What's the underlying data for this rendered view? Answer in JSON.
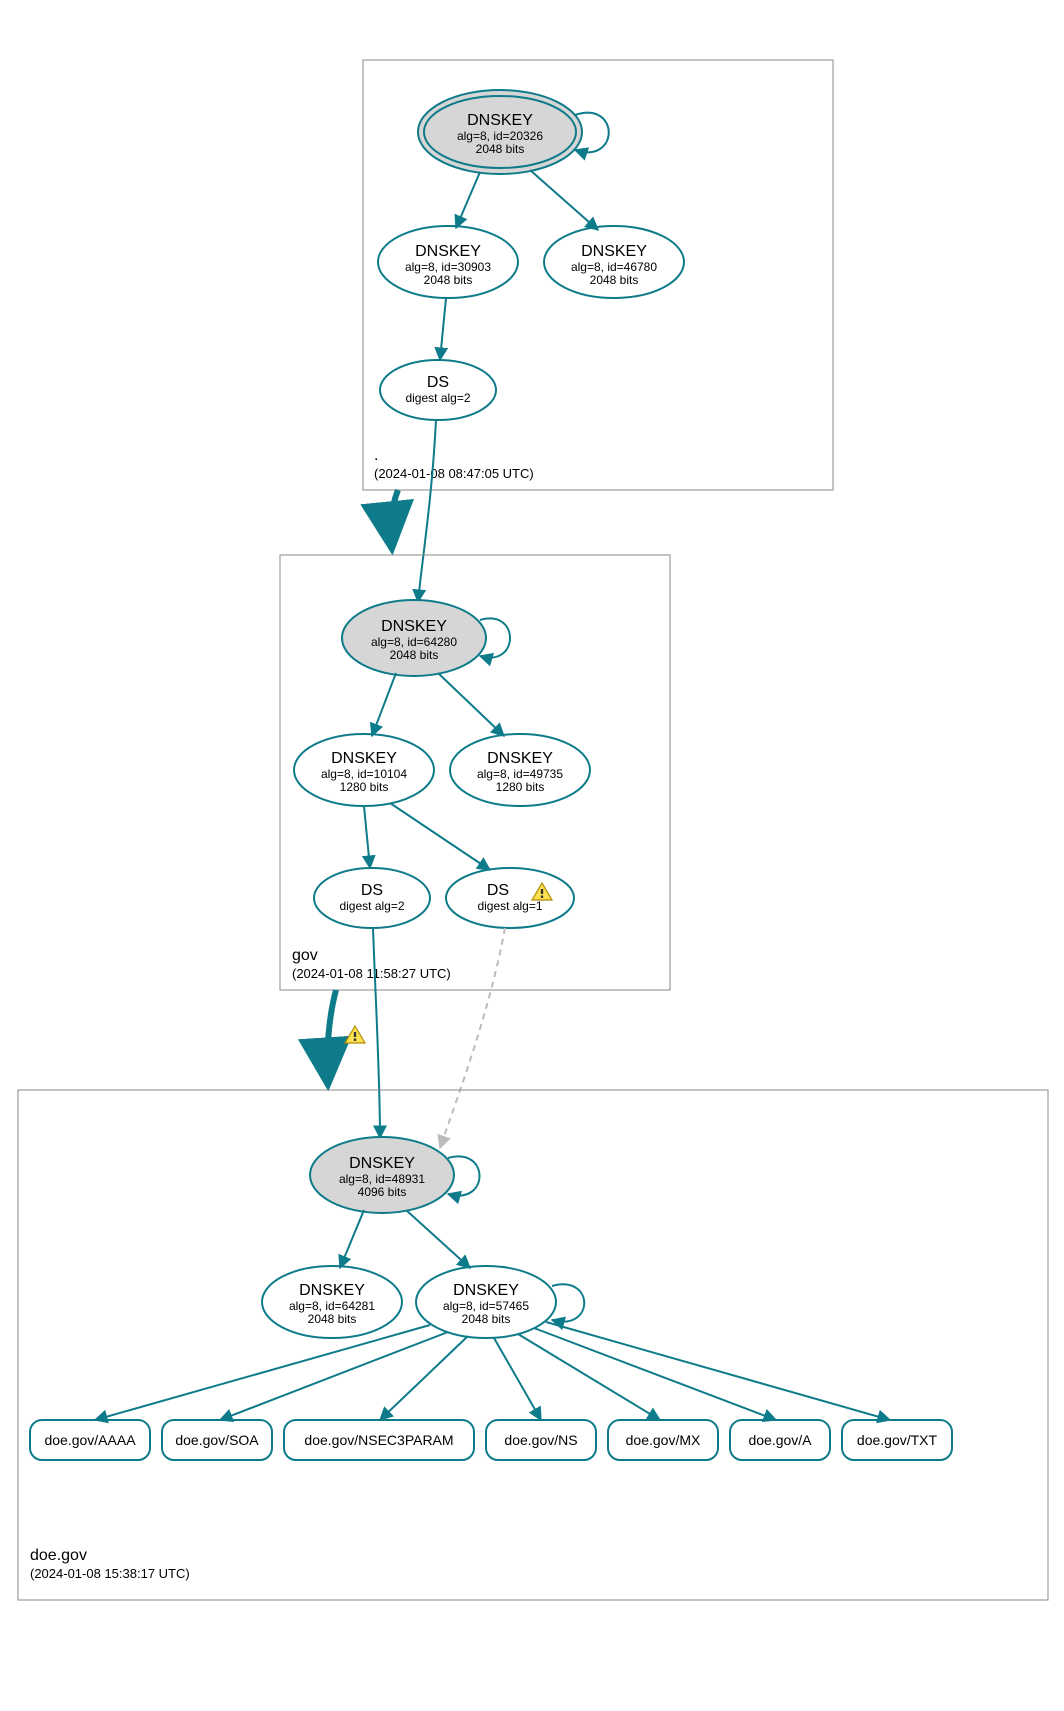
{
  "zones": {
    "root": {
      "name": ".",
      "timestamp": "(2024-01-08 08:47:05 UTC)"
    },
    "gov": {
      "name": "gov",
      "timestamp": "(2024-01-08 11:58:27 UTC)"
    },
    "doe": {
      "name": "doe.gov",
      "timestamp": "(2024-01-08 15:38:17 UTC)"
    }
  },
  "nodes": {
    "root_ksk": {
      "title": "DNSKEY",
      "sub1": "alg=8, id=20326",
      "sub2": "2048 bits"
    },
    "root_zsk1": {
      "title": "DNSKEY",
      "sub1": "alg=8, id=30903",
      "sub2": "2048 bits"
    },
    "root_zsk2": {
      "title": "DNSKEY",
      "sub1": "alg=8, id=46780",
      "sub2": "2048 bits"
    },
    "root_ds": {
      "title": "DS",
      "sub1": "digest alg=2"
    },
    "gov_ksk": {
      "title": "DNSKEY",
      "sub1": "alg=8, id=64280",
      "sub2": "2048 bits"
    },
    "gov_zsk1": {
      "title": "DNSKEY",
      "sub1": "alg=8, id=10104",
      "sub2": "1280 bits"
    },
    "gov_zsk2": {
      "title": "DNSKEY",
      "sub1": "alg=8, id=49735",
      "sub2": "1280 bits"
    },
    "gov_ds1": {
      "title": "DS",
      "sub1": "digest alg=2"
    },
    "gov_ds2": {
      "title": "DS",
      "sub1": "digest alg=1"
    },
    "doe_ksk": {
      "title": "DNSKEY",
      "sub1": "alg=8, id=48931",
      "sub2": "4096 bits"
    },
    "doe_zsk1": {
      "title": "DNSKEY",
      "sub1": "alg=8, id=64281",
      "sub2": "2048 bits"
    },
    "doe_zsk2": {
      "title": "DNSKEY",
      "sub1": "alg=8, id=57465",
      "sub2": "2048 bits"
    }
  },
  "rrsets": {
    "aaaa": "doe.gov/AAAA",
    "soa": "doe.gov/SOA",
    "nsec3param": "doe.gov/NSEC3PARAM",
    "ns": "doe.gov/NS",
    "mx": "doe.gov/MX",
    "a": "doe.gov/A",
    "txt": "doe.gov/TXT"
  }
}
